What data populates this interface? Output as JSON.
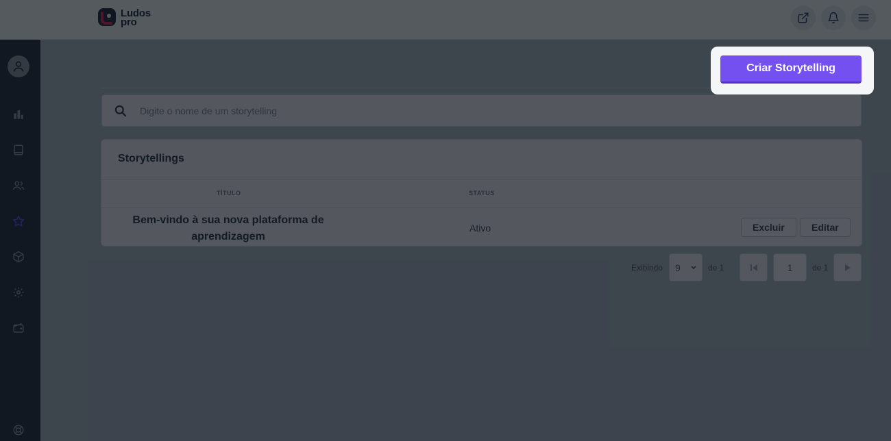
{
  "topbar": {
    "logo_line1": "Ludos",
    "logo_line2": "pro",
    "actions": [
      {
        "icon": "external-link-icon"
      },
      {
        "icon": "bell-icon"
      },
      {
        "icon": "menu-icon"
      }
    ]
  },
  "sidebar": {
    "items": [
      {
        "icon": "user-avatar-icon"
      },
      {
        "icon": "bar-chart-icon"
      },
      {
        "icon": "book-icon"
      },
      {
        "icon": "users-icon"
      },
      {
        "icon": "star-icon",
        "active": true
      },
      {
        "icon": "cube-icon"
      },
      {
        "icon": "gear-icon"
      },
      {
        "icon": "wallet-icon"
      },
      {
        "icon": "help-lifebuoy-icon"
      }
    ],
    "active_color": "#5b4cf0"
  },
  "actions": {
    "create_label": "Criar Storytelling",
    "accent": "#7450f0"
  },
  "search": {
    "placeholder": "Digite o nome de um storytelling",
    "value": ""
  },
  "table": {
    "title": "Storytellings",
    "columns": [
      "Título",
      "Status"
    ],
    "rows": [
      {
        "title": "Bem-vindo à sua nova plataforma de aprendizagem",
        "status": "Ativo",
        "delete_label": "Excluir",
        "edit_label": "Editar"
      }
    ]
  },
  "pagination": {
    "showing_label": "Exibindo",
    "per_page": "9",
    "of_label_1": "de 1",
    "current_page": "1",
    "of_label_2": "de 1"
  }
}
